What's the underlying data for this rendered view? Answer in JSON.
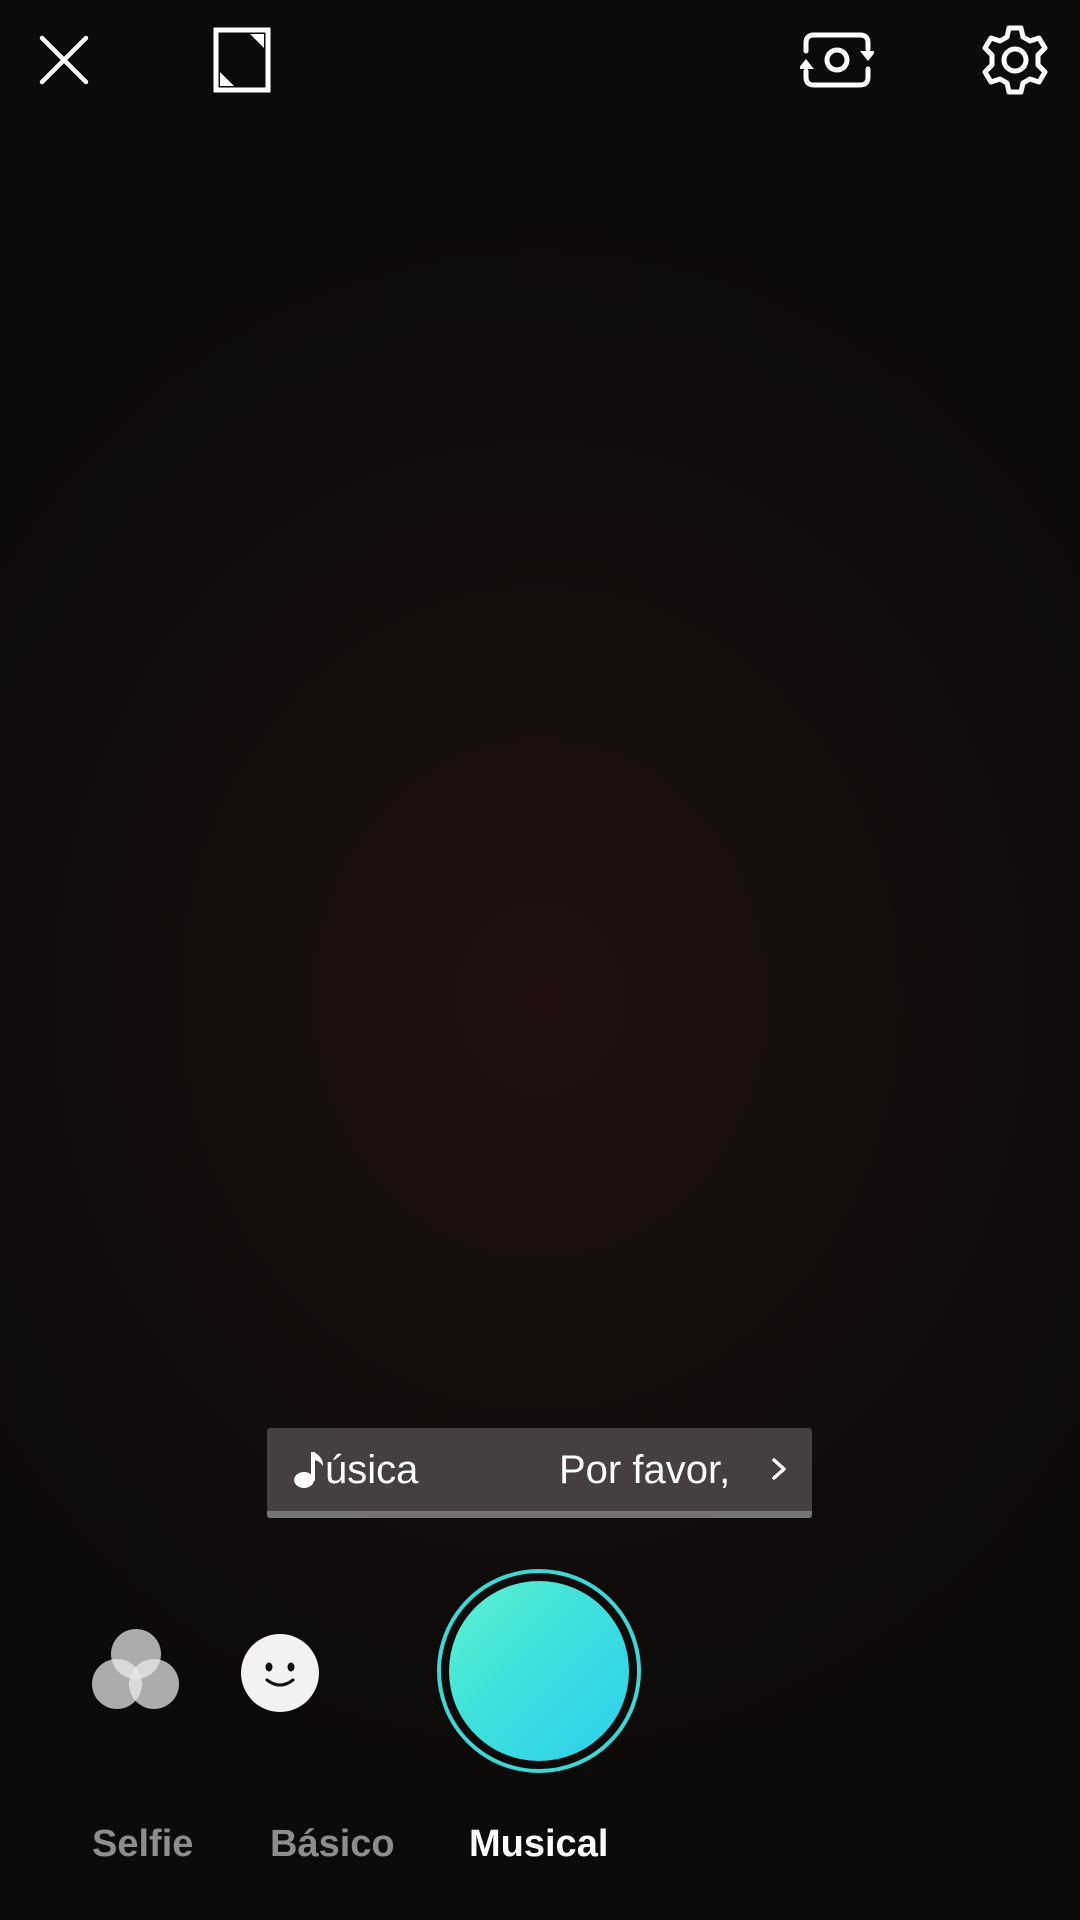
{
  "top_bar": {
    "close_icon": "close-icon",
    "aspect_ratio_icon": "aspect-ratio-icon",
    "flip_camera_icon": "flip-camera-icon",
    "settings_icon": "settings-icon"
  },
  "music_bar": {
    "icon": "music-note-icon",
    "label": "úsica",
    "prompt": "Por favor, e",
    "chevron_icon": "chevron-right-icon"
  },
  "controls": {
    "filters_icon": "filters-icon",
    "effects_icon": "face-effects-icon",
    "shutter_colors": [
      "#5cf3cf",
      "#2ccfee"
    ],
    "shutter_ring_color": "#3fd6d6"
  },
  "modes": [
    {
      "label": "Selfie",
      "active": false
    },
    {
      "label": "Básico",
      "active": false
    },
    {
      "label": "Musical",
      "active": true
    }
  ]
}
